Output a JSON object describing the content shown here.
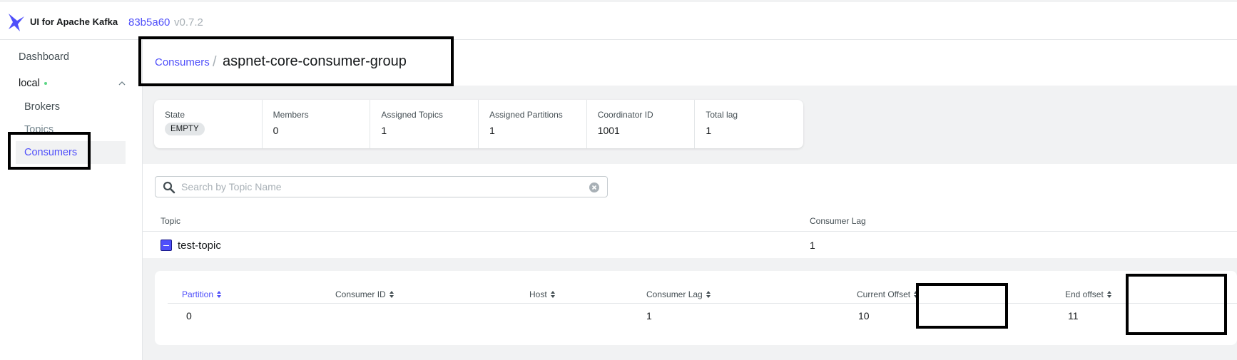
{
  "header": {
    "brand": "UI for Apache Kafka",
    "commit": "83b5a60",
    "version": "v0.7.2"
  },
  "sidebar": {
    "dashboard": "Dashboard",
    "cluster": "local",
    "cluster_status": "online",
    "items": [
      {
        "label": "Brokers"
      },
      {
        "label": "Topics"
      },
      {
        "label": "Consumers",
        "active": true
      }
    ]
  },
  "breadcrumb": {
    "parent": "Consumers",
    "separator": "/",
    "current": "aspnet-core-consumer-group"
  },
  "metrics": [
    {
      "label": "State",
      "value": "EMPTY"
    },
    {
      "label": "Members",
      "value": "0"
    },
    {
      "label": "Assigned Topics",
      "value": "1"
    },
    {
      "label": "Assigned Partitions",
      "value": "1"
    },
    {
      "label": "Coordinator ID",
      "value": "1001"
    },
    {
      "label": "Total lag",
      "value": "1"
    }
  ],
  "search": {
    "placeholder": "Search by Topic Name",
    "value": ""
  },
  "topics_table": {
    "columns": [
      "Topic",
      "Consumer Lag"
    ],
    "rows": [
      {
        "topic": "test-topic",
        "lag": "1",
        "expanded": true
      }
    ]
  },
  "partitions_table": {
    "columns": [
      "Partition",
      "Consumer ID",
      "Host",
      "Consumer Lag",
      "Current Offset",
      "End offset"
    ],
    "active_sort": "Partition",
    "rows": [
      {
        "partition": "0",
        "consumer_id": "",
        "host": "",
        "lag": "1",
        "current_offset": "10",
        "end_offset": "11"
      }
    ]
  },
  "colors": {
    "accent": "#4f4ffa",
    "status_online": "#5cd685",
    "annotation": "#000000"
  }
}
